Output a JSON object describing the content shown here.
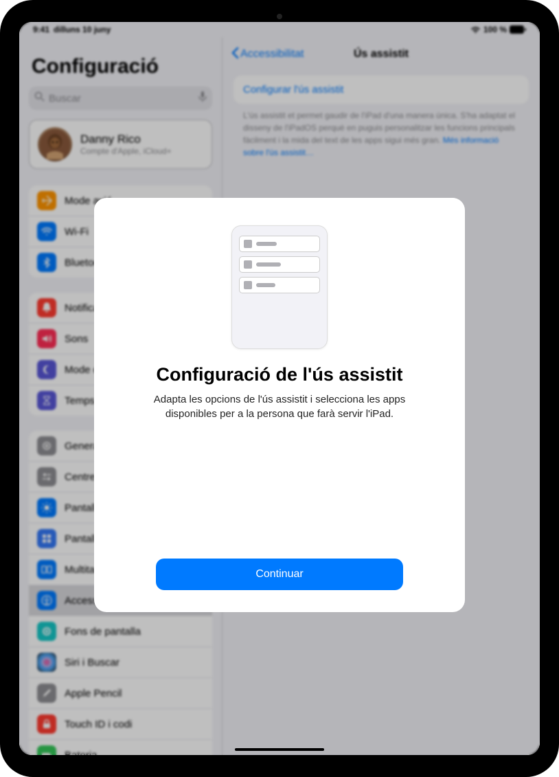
{
  "status": {
    "time": "9:41",
    "date": "dilluns 10 juny",
    "battery_text": "100 %"
  },
  "sidebar": {
    "title": "Configuració",
    "search_placeholder": "Buscar",
    "profile": {
      "name": "Danny Rico",
      "subtitle": "Compte d'Apple, iCloud+"
    },
    "group1": [
      {
        "label": "Mode avió",
        "color": "#ff9500",
        "icon": "airplane"
      },
      {
        "label": "Wi-Fi",
        "color": "#007aff",
        "icon": "wifi"
      },
      {
        "label": "Bluetooth",
        "color": "#007aff",
        "icon": "bluetooth"
      }
    ],
    "group2": [
      {
        "label": "Notificacions",
        "color": "#ff3b30",
        "icon": "bell"
      },
      {
        "label": "Sons",
        "color": "#ff2d55",
        "icon": "speaker"
      },
      {
        "label": "Mode concentració",
        "color": "#5856d6",
        "icon": "moon"
      },
      {
        "label": "Temps d'ús",
        "color": "#5856d6",
        "icon": "hourglass"
      }
    ],
    "group3": [
      {
        "label": "General",
        "color": "#8e8e93",
        "icon": "gear"
      },
      {
        "label": "Centre de control",
        "color": "#8e8e93",
        "icon": "switches"
      },
      {
        "label": "Pantalla i brillantor",
        "color": "#007aff",
        "icon": "brightness"
      },
      {
        "label": "Pantalla d'inici i biblioteca",
        "color": "#3478f6",
        "icon": "grid"
      },
      {
        "label": "Multitasca",
        "color": "#007aff",
        "icon": "multitask"
      },
      {
        "label": "Accessibilitat",
        "color": "#007aff",
        "icon": "accessibility",
        "selected": true
      },
      {
        "label": "Fons de pantalla",
        "color": "#16c7c7",
        "icon": "wallpaper"
      },
      {
        "label": "Siri i Buscar",
        "color": "#222",
        "icon": "siri"
      },
      {
        "label": "Apple Pencil",
        "color": "#8e8e93",
        "icon": "pencil"
      },
      {
        "label": "Touch ID i codi",
        "color": "#ff3b30",
        "icon": "lock"
      },
      {
        "label": "Bateria",
        "color": "#34c759",
        "icon": "battery"
      }
    ]
  },
  "detail": {
    "back_label": "Accessibilitat",
    "title": "Ús assistit",
    "link_label": "Configurar l'ús assistit",
    "description": "L'ús assistit et permet gaudir de l'iPad d'una manera única. S'ha adaptat el disseny de l'iPadOS perquè en puguis personalitzar les funcions principals fàcilment i la mida del text de les apps sigui més gran.",
    "more_link": "Més informació sobre l'ús assistit…"
  },
  "modal": {
    "title": "Configuració de l'ús assistit",
    "description": "Adapta les opcions de l'ús assistit i selecciona les apps disponibles per a la persona que farà servir l'iPad.",
    "button_label": "Continuar"
  }
}
